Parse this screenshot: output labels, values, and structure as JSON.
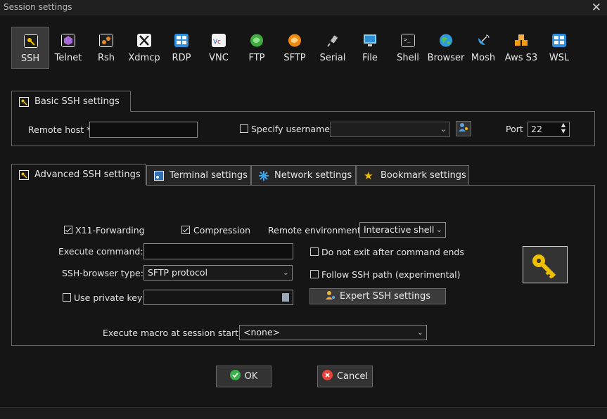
{
  "window": {
    "title": "Session settings"
  },
  "protocols": [
    {
      "label": "SSH",
      "icon": "key-icon",
      "selected": true
    },
    {
      "label": "Telnet",
      "icon": "telnet-icon"
    },
    {
      "label": "Rsh",
      "icon": "rsh-icon"
    },
    {
      "label": "Xdmcp",
      "icon": "xdmcp-icon"
    },
    {
      "label": "RDP",
      "icon": "rdp-icon"
    },
    {
      "label": "VNC",
      "icon": "vnc-icon"
    },
    {
      "label": "FTP",
      "icon": "ftp-icon"
    },
    {
      "label": "SFTP",
      "icon": "sftp-icon"
    },
    {
      "label": "Serial",
      "icon": "serial-plug-icon"
    },
    {
      "label": "File",
      "icon": "file-monitor-icon"
    },
    {
      "label": "Shell",
      "icon": "shell-terminal-icon"
    },
    {
      "label": "Browser",
      "icon": "globe-icon"
    },
    {
      "label": "Mosh",
      "icon": "satellite-dish-icon"
    },
    {
      "label": "Aws S3",
      "icon": "aws-cubes-icon"
    },
    {
      "label": "WSL",
      "icon": "windows-icon"
    }
  ],
  "basic": {
    "tab_label": "Basic SSH settings",
    "remote_host_label": "Remote host *",
    "remote_host_value": "",
    "specify_username_label": "Specify username",
    "username_value": "",
    "port_label": "Port",
    "port_value": "22"
  },
  "tabs": [
    {
      "label": "Advanced SSH settings",
      "active": true
    },
    {
      "label": "Terminal settings"
    },
    {
      "label": "Network settings"
    },
    {
      "label": "Bookmark settings"
    }
  ],
  "advanced": {
    "x11_label": "X11-Forwarding",
    "x11_checked": true,
    "compression_label": "Compression",
    "compression_checked": true,
    "remote_env_label": "Remote environment:",
    "remote_env_value": "Interactive shell",
    "exec_cmd_label": "Execute command:",
    "exec_cmd_value": "",
    "no_exit_label": "Do not exit after command ends",
    "browser_type_label": "SSH-browser type:",
    "browser_type_value": "SFTP protocol",
    "follow_path_label": "Follow SSH path (experimental)",
    "private_key_label": "Use private key",
    "private_key_value": "",
    "expert_label": "Expert SSH settings",
    "macro_label": "Execute macro at session start:",
    "macro_value": "<none>"
  },
  "buttons": {
    "ok": "OK",
    "cancel": "Cancel"
  },
  "colors": {
    "key_yellow": "#f0c000",
    "ok_green": "#3cb04a",
    "cancel_red": "#e0463c"
  }
}
